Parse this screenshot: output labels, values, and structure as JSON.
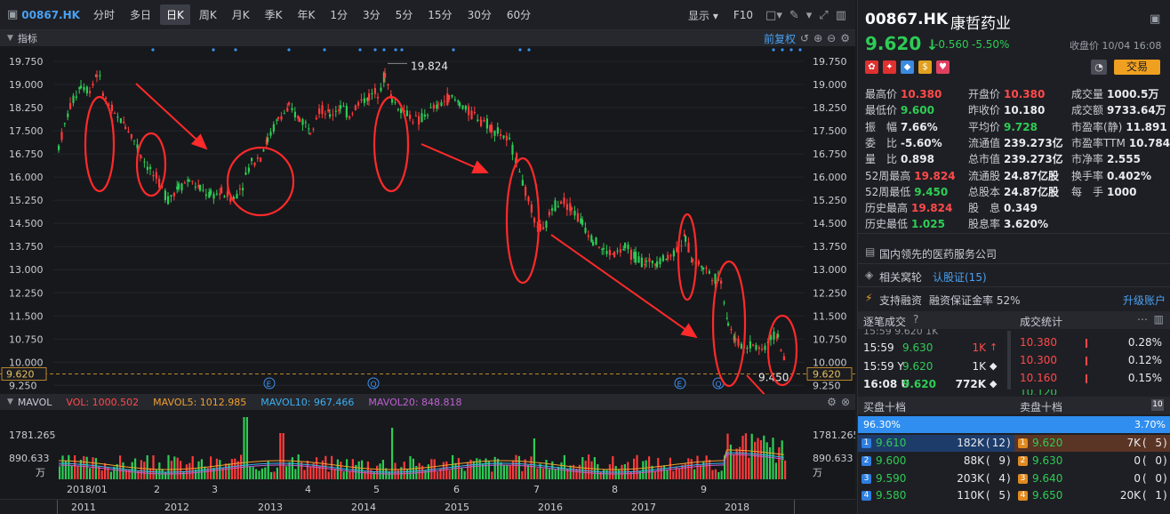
{
  "toolbar": {
    "code": "00867.HK",
    "periods": [
      "分时",
      "多日",
      "日K",
      "周K",
      "月K",
      "季K",
      "年K",
      "1分",
      "3分",
      "5分",
      "15分",
      "30分",
      "60分"
    ],
    "active_period": "日K",
    "display_label": "显示",
    "f10_label": "F10"
  },
  "indicator": {
    "label": "指标",
    "adjust_label": "前复权"
  },
  "kline": {
    "y_ticks": [
      "19.750",
      "19.000",
      "18.250",
      "17.500",
      "16.750",
      "16.000",
      "15.250",
      "14.500",
      "13.750",
      "13.000",
      "12.250",
      "11.500",
      "10.750",
      "10.000",
      "9.250"
    ],
    "high_label": "19.824",
    "low_label": "9.450",
    "current_price_label": "9.620",
    "marker_e": "E",
    "marker_q": "Q"
  },
  "volume": {
    "label": "MAVOL",
    "vol": "VOL: 1000.502",
    "mavol5": "MAVOL5: 1012.985",
    "mavol10": "MAVOL10: 967.466",
    "mavol20": "MAVOL20: 848.818",
    "y_ticks": [
      "1781.265",
      "890.633",
      "万"
    ],
    "x_ticks": [
      "2018/01",
      "2",
      "3",
      "4",
      "5",
      "6",
      "7",
      "8",
      "9"
    ]
  },
  "years": [
    "2011",
    "2012",
    "2013",
    "2014",
    "2015",
    "2016",
    "2017",
    "2018"
  ],
  "colors": {
    "up": "#ff3b3b",
    "down": "#2ecc55",
    "mavol5": "#f0a030",
    "mavol10": "#3ab0f0",
    "mavol20": "#c060d0",
    "annotation": "#ff2a2a"
  },
  "quote": {
    "code": "00867.HK",
    "name": "康哲药业",
    "price": "9.620",
    "change": "-0.560",
    "change_pct": "-5.50%",
    "close_time": "收盘价 10/04 16:08",
    "trade_button": "交易"
  },
  "stats": [
    {
      "k": "最高价",
      "v": "10.380",
      "c": "red"
    },
    {
      "k": "开盘价",
      "v": "10.380",
      "c": "red"
    },
    {
      "k": "成交量",
      "v": "1000.5万",
      "c": "white"
    },
    {
      "k": "最低价",
      "v": "9.600",
      "c": "green"
    },
    {
      "k": "昨收价",
      "v": "10.180",
      "c": "white"
    },
    {
      "k": "成交额",
      "v": "9733.64万",
      "c": "white"
    },
    {
      "k": "振　幅",
      "v": "7.66%",
      "c": "white"
    },
    {
      "k": "平均价",
      "v": "9.728",
      "c": "green"
    },
    {
      "k": "市盈率(静)",
      "v": "11.891",
      "c": "white"
    },
    {
      "k": "委　比",
      "v": "-5.60%",
      "c": "white"
    },
    {
      "k": "流通值",
      "v": "239.273亿",
      "c": "white"
    },
    {
      "k": "市盈率TTM",
      "v": "10.784",
      "c": "white"
    },
    {
      "k": "量　比",
      "v": "0.898",
      "c": "white"
    },
    {
      "k": "总市值",
      "v": "239.273亿",
      "c": "white"
    },
    {
      "k": "市净率",
      "v": "2.555",
      "c": "white"
    },
    {
      "k": "52周最高",
      "v": "19.824",
      "c": "red"
    },
    {
      "k": "流通股",
      "v": "24.87亿股",
      "c": "white"
    },
    {
      "k": "换手率",
      "v": "0.402%",
      "c": "white"
    },
    {
      "k": "52周最低",
      "v": "9.450",
      "c": "green"
    },
    {
      "k": "总股本",
      "v": "24.87亿股",
      "c": "white"
    },
    {
      "k": "每　手",
      "v": "1000",
      "c": "white"
    },
    {
      "k": "历史最高",
      "v": "19.824",
      "c": "red"
    },
    {
      "k": "股　息",
      "v": "0.349",
      "c": "white"
    },
    {
      "k": "历史最低",
      "v": "1.025",
      "c": "green"
    },
    {
      "k": "股息率",
      "v": "3.620%",
      "c": "white"
    }
  ],
  "info": {
    "company_desc": "国内领先的医药服务公司",
    "related_label": "相关窝轮",
    "related_link": "认股证(15)",
    "margin_label": "支持融资",
    "margin_ratio": "融资保证金率 52%",
    "upgrade": "升级账户"
  },
  "ticks_head": {
    "left": "逐笔成交",
    "right": "成交统计"
  },
  "ticks": [
    {
      "time": "15:59",
      "price": "9.630",
      "vol": "1K",
      "dir": "up",
      "pc": "green"
    },
    {
      "time": "15:59 Y",
      "price": "9.620",
      "vol": "1K",
      "dir": "flat",
      "pc": "green"
    },
    {
      "time": "16:08 U",
      "price": "9.620",
      "vol": "772K",
      "dir": "flat",
      "pc": "green"
    }
  ],
  "tick_stats": [
    {
      "price": "10.380",
      "pct": "0.28%"
    },
    {
      "price": "10.300",
      "pct": "0.12%"
    },
    {
      "price": "10.160",
      "pct": "0.15%"
    }
  ],
  "book_head": {
    "bid": "买盘十档",
    "ask": "卖盘十档",
    "level": "10"
  },
  "book_ratio": {
    "bid": "96.30%",
    "ask": "3.70%"
  },
  "bids": [
    {
      "n": "1",
      "price": "9.610",
      "vol": "182K",
      "orders": "12"
    },
    {
      "n": "2",
      "price": "9.600",
      "vol": "88K",
      "orders": "9"
    },
    {
      "n": "3",
      "price": "9.590",
      "vol": "203K",
      "orders": "4"
    },
    {
      "n": "4",
      "price": "9.580",
      "vol": "110K",
      "orders": "5"
    }
  ],
  "asks": [
    {
      "n": "1",
      "price": "9.620",
      "vol": "7K",
      "orders": "5"
    },
    {
      "n": "2",
      "price": "9.630",
      "vol": "0",
      "orders": "0"
    },
    {
      "n": "3",
      "price": "9.640",
      "vol": "0",
      "orders": "0"
    },
    {
      "n": "4",
      "price": "9.650",
      "vol": "20K",
      "orders": "1"
    }
  ]
}
